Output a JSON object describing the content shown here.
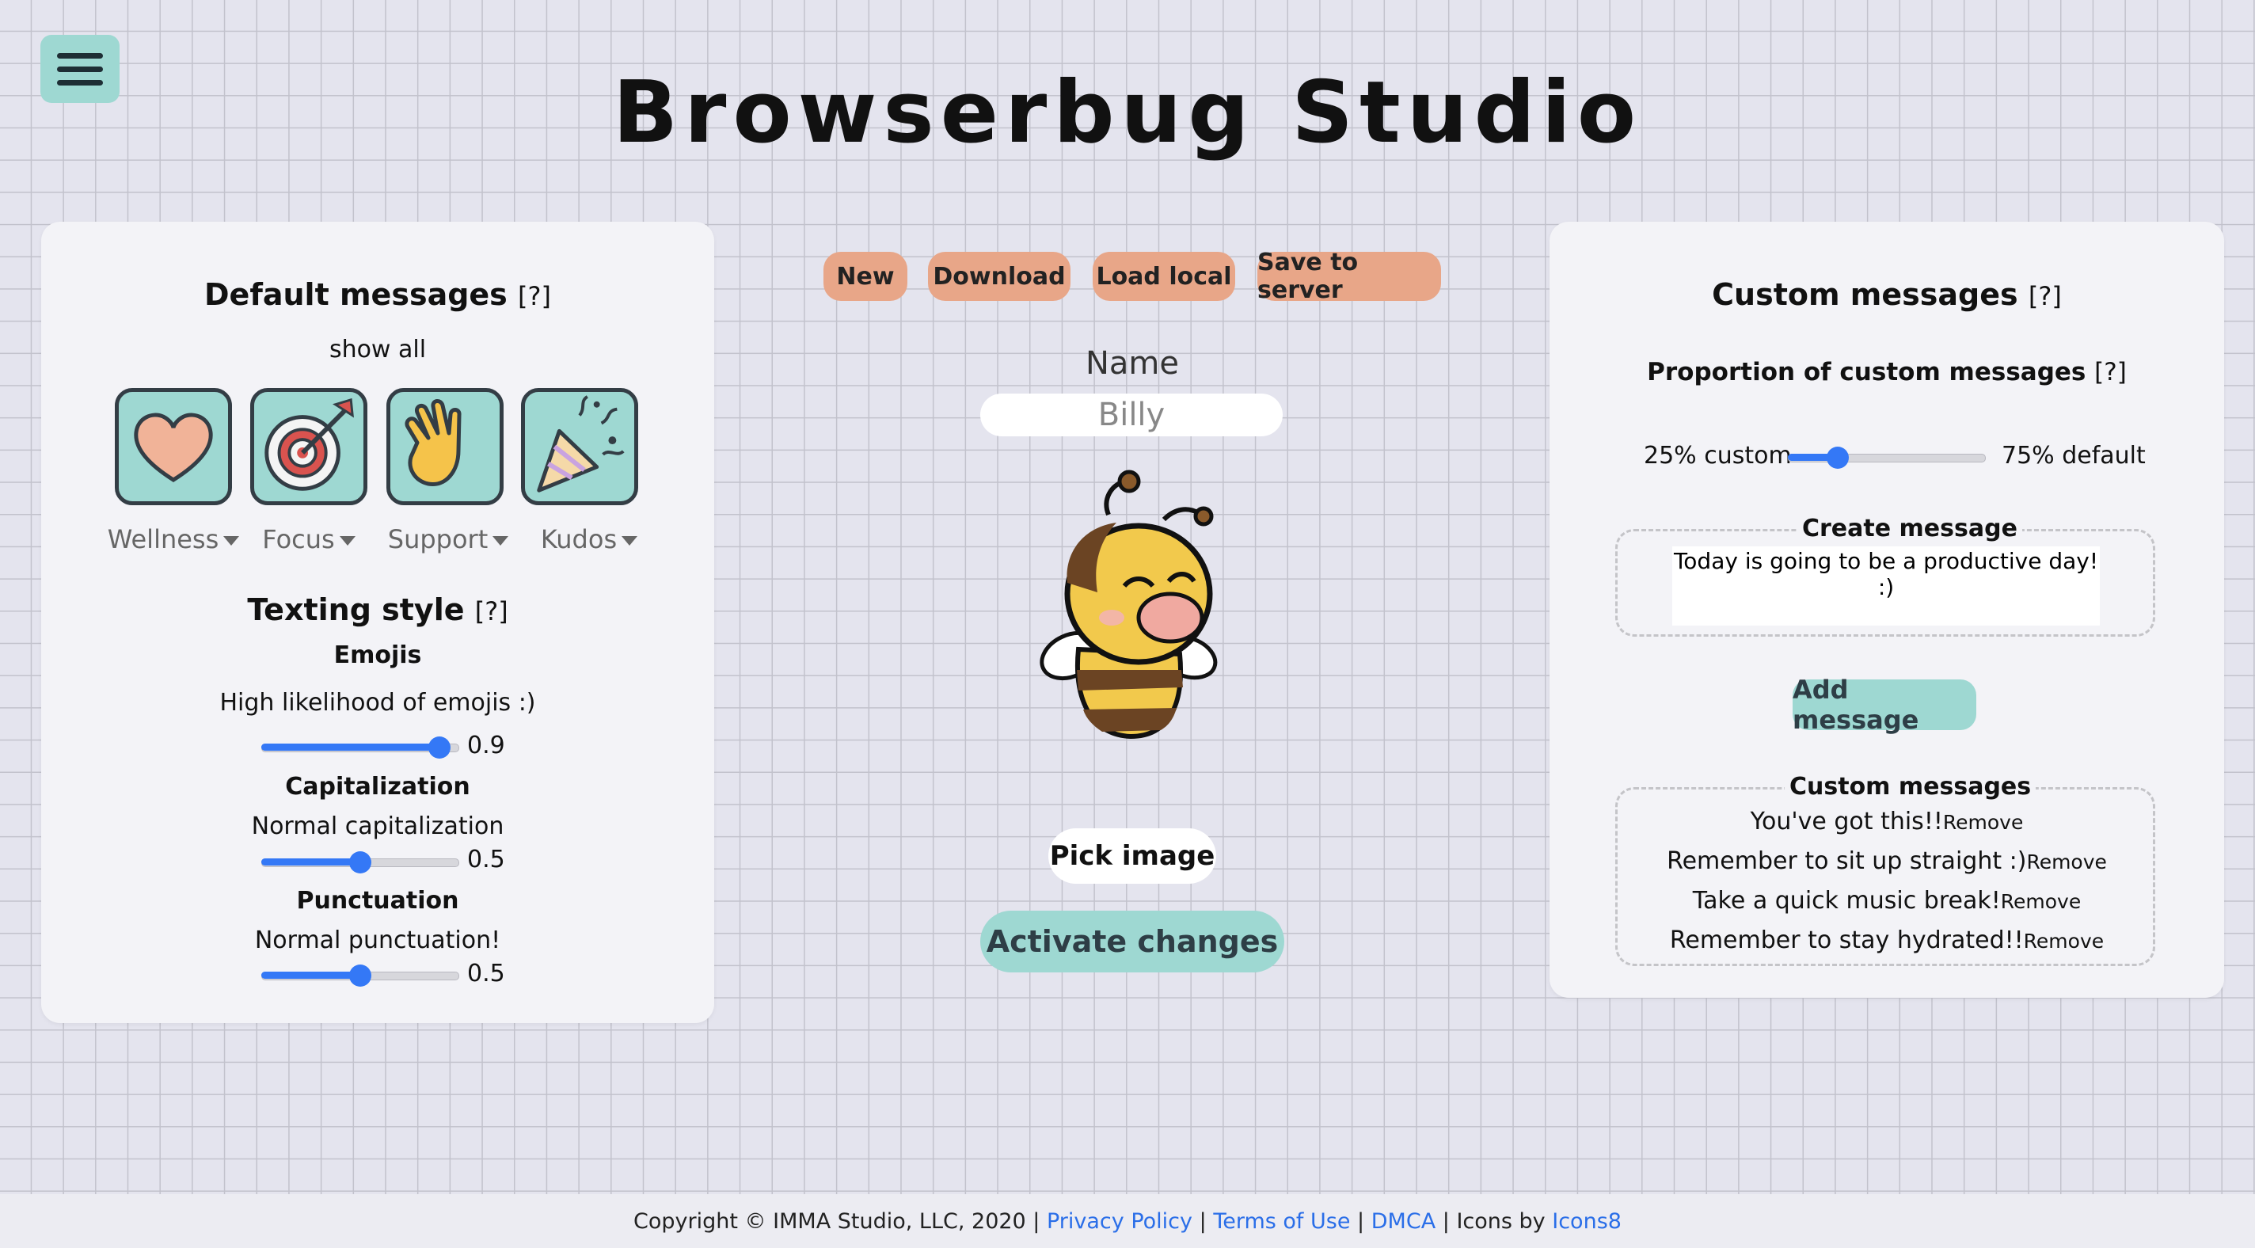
{
  "app": {
    "title": "Browserbug Studio"
  },
  "left_panel": {
    "default_messages_title": "Default messages",
    "help": "[?]",
    "show_all": "show all",
    "categories": [
      {
        "label": "Wellness",
        "icon": "heart-icon"
      },
      {
        "label": "Focus",
        "icon": "target-icon"
      },
      {
        "label": "Support",
        "icon": "clapping-hands-icon"
      },
      {
        "label": "Kudos",
        "icon": "party-popper-icon"
      }
    ],
    "texting_style_title": "Texting style",
    "emojis": {
      "title": "Emojis",
      "description": "High likelihood of emojis :)",
      "value": "0.9",
      "fraction": 0.9
    },
    "capitalization": {
      "title": "Capitalization",
      "description": "Normal capitalization",
      "value": "0.5",
      "fraction": 0.5
    },
    "punctuation": {
      "title": "Punctuation",
      "description": "Normal punctuation!",
      "value": "0.5",
      "fraction": 0.5
    }
  },
  "toolbar": {
    "new": "New",
    "download": "Download",
    "load_local": "Load local",
    "save_to_server": "Save to server"
  },
  "center": {
    "name_label": "Name",
    "name_value": "Billy",
    "pick_image": "Pick image",
    "activate_changes": "Activate changes"
  },
  "right_panel": {
    "custom_messages_title": "Custom messages",
    "help": "[?]",
    "proportion_title": "Proportion of custom messages",
    "custom_label": "25% custom",
    "default_label": "75% default",
    "proportion_fraction": 0.25,
    "create_message_legend": "Create message",
    "create_message_value": "Today is going to be a productive day! :)",
    "add_message": "Add message",
    "custom_list_legend": "Custom messages",
    "remove_label": "Remove",
    "messages": [
      "You've got this!!",
      "Remember to sit up straight :)",
      "Take a quick music break!",
      "Remember to stay hydrated!!"
    ]
  },
  "footer": {
    "copyright": "Copyright © IMMA Studio, LLC, 2020 |",
    "privacy": "Privacy Policy",
    "sep": "|",
    "terms": "Terms of Use",
    "dmca": "DMCA",
    "icons_by": "| Icons by",
    "icons8": "Icons8"
  },
  "colors": {
    "teal": "#9ed8d2",
    "salmon": "#e8a688",
    "slider_blue": "#3478f6",
    "link_blue": "#2a6ee8"
  }
}
